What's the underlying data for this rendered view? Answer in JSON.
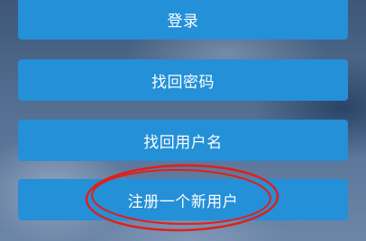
{
  "menu": {
    "login_label": "登录",
    "recover_password_label": "找回密码",
    "recover_username_label": "找回用户名",
    "register_label": "注册一个新用户"
  },
  "annotation": {
    "color": "#e0201b"
  }
}
